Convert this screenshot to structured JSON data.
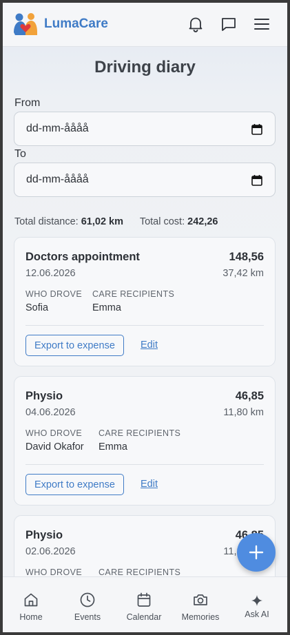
{
  "app": {
    "brand": "LumaCare",
    "brand_color": "#3f7bc6"
  },
  "header": {
    "icons": [
      "bell-icon",
      "chat-icon",
      "menu-icon"
    ]
  },
  "page": {
    "title": "Driving diary"
  },
  "filters": {
    "from_label": "From",
    "from_value": "dd-mm-åååå",
    "to_label": "To",
    "to_value": "dd-mm-åååå"
  },
  "totals": {
    "distance_label": "Total distance:",
    "distance_value": "61,02 km",
    "cost_label": "Total cost:",
    "cost_value": "242,26"
  },
  "trips": [
    {
      "title": "Doctors appointment",
      "date": "12.06.2026",
      "cost": "148,56",
      "distance": "37,42 km",
      "who_drove_label": "WHO DROVE",
      "who_drove": "Sofia",
      "recipients_label": "CARE RECIPIENTS",
      "recipients": "Emma",
      "export_label": "Export to expense",
      "edit_label": "Edit"
    },
    {
      "title": "Physio",
      "date": "04.06.2026",
      "cost": "46,85",
      "distance": "11,80 km",
      "who_drove_label": "WHO DROVE",
      "who_drove": "David Okafor",
      "recipients_label": "CARE RECIPIENTS",
      "recipients": "Emma",
      "export_label": "Export to expense",
      "edit_label": "Edit"
    },
    {
      "title": "Physio",
      "date": "02.06.2026",
      "cost": "46,85",
      "distance": "11,80 km",
      "who_drove_label": "WHO DROVE",
      "recipients_label": "CARE RECIPIENTS"
    }
  ],
  "bottom_nav": [
    {
      "label": "Home",
      "icon": "home-icon"
    },
    {
      "label": "Events",
      "icon": "clock-icon"
    },
    {
      "label": "Calendar",
      "icon": "calendar-icon"
    },
    {
      "label": "Memories",
      "icon": "camera-icon"
    },
    {
      "label": "Ask AI",
      "icon": "sparkle-icon"
    }
  ],
  "fab": {
    "icon": "plus-icon",
    "color": "#4f8ce0"
  }
}
